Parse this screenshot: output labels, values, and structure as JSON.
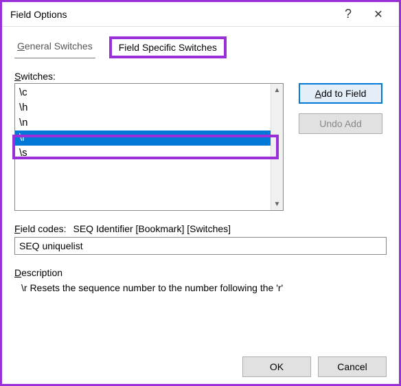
{
  "title": "Field Options",
  "titlebar": {
    "help": "?",
    "close": "✕"
  },
  "tabs": {
    "general": {
      "pre": "",
      "uchar": "G",
      "rest": "eneral Switches"
    },
    "specific": "Field Specific Switches"
  },
  "switches_label": {
    "uchar": "S",
    "rest": "witches:"
  },
  "switches": {
    "items": [
      "\\c",
      "\\h",
      "\\n",
      "\\r",
      "\\s"
    ],
    "selected_index": 3
  },
  "buttons": {
    "add": {
      "uchar": "A",
      "rest": "dd to Field"
    },
    "undo": "Undo Add",
    "ok": "OK",
    "cancel": "Cancel"
  },
  "field_codes": {
    "label": {
      "uchar": "F",
      "rest": "ield codes:"
    },
    "syntax": "SEQ Identifier [Bookmark] [Switches]",
    "value": "SEQ uniquelist"
  },
  "description": {
    "label": {
      "uchar": "D",
      "rest": "escription"
    },
    "text": "\\r Resets the sequence number to the number following the 'r'"
  }
}
